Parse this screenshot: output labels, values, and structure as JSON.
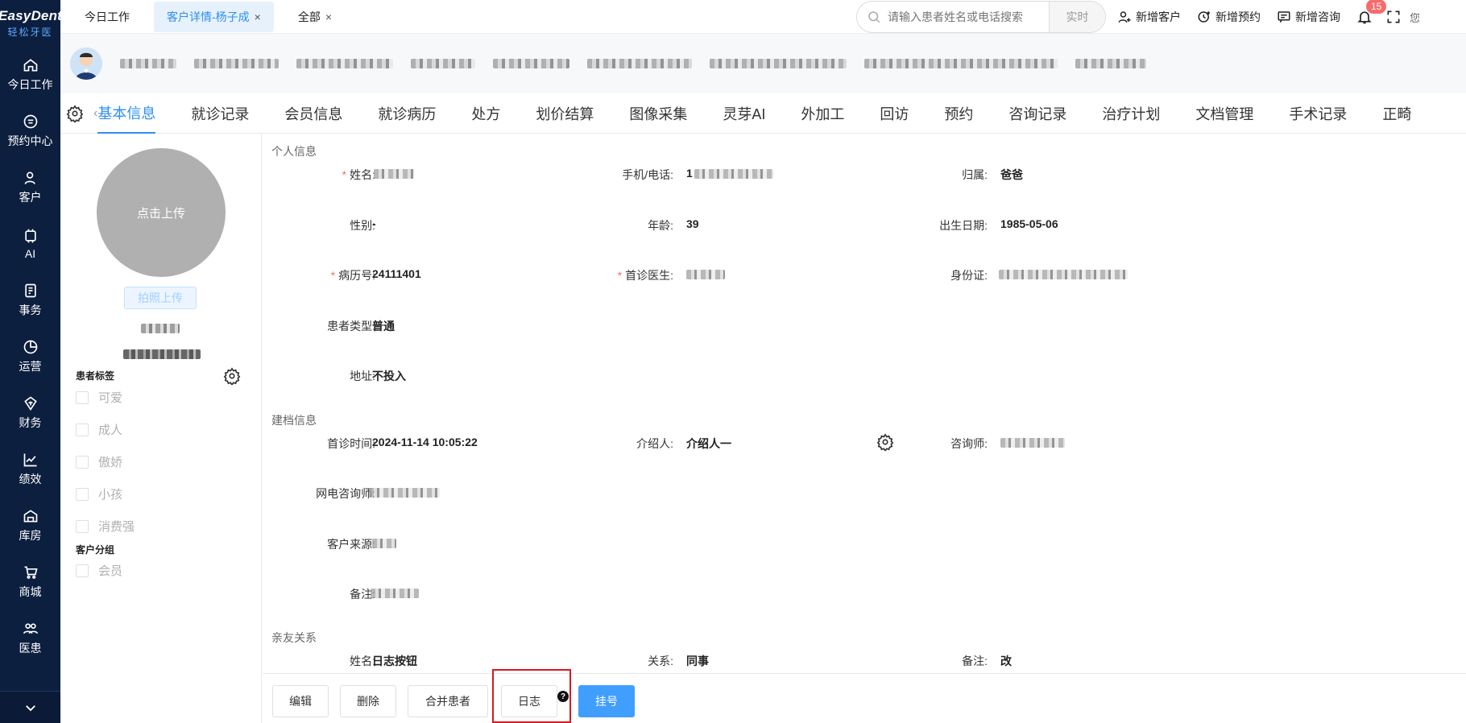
{
  "brand": {
    "name_en": "EasyDent",
    "name_cn": "轻松牙医"
  },
  "sidebar": {
    "items": [
      {
        "label": "今日工作",
        "icon": "home-icon"
      },
      {
        "label": "预约中心",
        "icon": "calendar-icon"
      },
      {
        "label": "客户",
        "icon": "user-icon"
      },
      {
        "label": "AI",
        "icon": "ai-chip-icon"
      },
      {
        "label": "事务",
        "icon": "task-icon"
      },
      {
        "label": "运营",
        "icon": "pie-chart-icon"
      },
      {
        "label": "财务",
        "icon": "finance-icon"
      },
      {
        "label": "绩效",
        "icon": "line-chart-icon"
      },
      {
        "label": "库房",
        "icon": "warehouse-icon"
      },
      {
        "label": "商城",
        "icon": "cart-icon"
      },
      {
        "label": "医患",
        "icon": "doctor-patient-icon"
      }
    ]
  },
  "topbar": {
    "tabs": [
      {
        "label": "今日工作",
        "closable": false,
        "active": false
      },
      {
        "label": "客户详情-杨子成",
        "closable": true,
        "active": true
      },
      {
        "label": "全部",
        "closable": true,
        "active": false
      }
    ],
    "close_symbol": "×",
    "search": {
      "placeholder": "请输入患者姓名或电话搜索",
      "mode": "实时"
    },
    "actions": [
      {
        "label": "新增客户",
        "icon": "add-user-icon"
      },
      {
        "label": "新增预约",
        "icon": "add-appointment-icon"
      },
      {
        "label": "新增咨询",
        "icon": "add-consult-icon"
      }
    ],
    "notification_count": "15",
    "more": "您"
  },
  "subtabs": [
    "基本信息",
    "就诊记录",
    "会员信息",
    "就诊病历",
    "处方",
    "划价结算",
    "图像采集",
    "灵芽AI",
    "外加工",
    "回访",
    "预约",
    "咨询记录",
    "治疗计划",
    "文档管理",
    "手术记录",
    "正畸"
  ],
  "subtabs_back": "‹",
  "left": {
    "upload_label": "点击上传",
    "photo_button": "拍照上传",
    "tags_title": "患者标签",
    "tags": [
      "可爱",
      "成人",
      "傲娇",
      "小孩",
      "消费强"
    ],
    "group_title": "客户分组",
    "groups": [
      "会员"
    ]
  },
  "form": {
    "personal_title": "个人信息",
    "name_label": "姓名:",
    "name_req": "*",
    "phone_label": "手机/电话:",
    "phone_prefix": "1",
    "relation_label": "归属:",
    "relation_value": "爸爸",
    "gender_label": "性别:",
    "gender_value": "-",
    "age_label": "年龄:",
    "age_value": "39",
    "birth_label": "出生日期:",
    "birth_value": "1985-05-06",
    "record_label": "病历号:",
    "record_value": "24111401",
    "record_req": "*",
    "doctor_label": "首诊医生:",
    "doctor_req": "*",
    "id_label": "身份证:",
    "type_label": "患者类型:",
    "type_value": "普通",
    "address_label": "地址:",
    "address_value": "不投入",
    "archive_title": "建档信息",
    "first_time_label": "首诊时间:",
    "first_time_value": "2024-11-14 10:05:22",
    "referrer_label": "介绍人:",
    "referrer_value": "介绍人一",
    "consultant_label": "咨询师:",
    "tele_label": "网电咨询师:",
    "source_label": "客户来源:",
    "remark_label": "备注:",
    "family_title": "亲友关系",
    "f_name_label": "姓名:",
    "f_name_value": "日志按钮",
    "f_rel_label": "关系:",
    "f_rel_value": "同事",
    "f_remark_label": "备注:",
    "f_remark_value": "改"
  },
  "footer": {
    "edit": "编辑",
    "delete": "删除",
    "merge": "合并患者",
    "log": "日志",
    "register": "挂号",
    "help": "?"
  }
}
